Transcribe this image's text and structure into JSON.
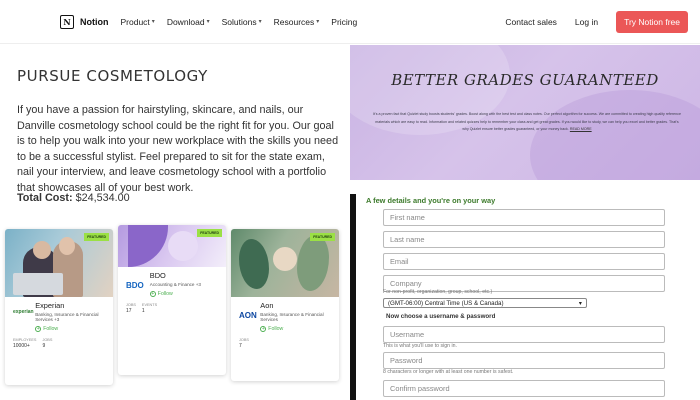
{
  "nav": {
    "logo_text": "Notion",
    "menu": [
      {
        "label": "Product",
        "has_chevron": true
      },
      {
        "label": "Download",
        "has_chevron": true
      },
      {
        "label": "Solutions",
        "has_chevron": true
      },
      {
        "label": "Resources",
        "has_chevron": true
      },
      {
        "label": "Pricing",
        "has_chevron": false
      }
    ],
    "contact": "Contact sales",
    "login": "Log in",
    "cta": "Try Notion free",
    "cta_color": "#eb5757"
  },
  "cosmo": {
    "title": "PURSUE COSMETOLOGY",
    "body": "If you have a passion for hairstyling, skincare, and nails, our Danville cosmetology school could be the right fit for you. Our goal is to help you walk into your new workplace with the skills you need to be a successful stylist. Feel prepared to sit for the state exam, nail your interview, and leave cosmetology school with a portfolio that showcases all of your best work.",
    "cost_label": "Total Cost:",
    "cost_value": "$24,534.00"
  },
  "banner": {
    "title": "BETTER GRADES GUARANTEED",
    "small_text": "It's a proven fact that Quizlet study boosts students' grades. Boost along with the best test and class notes. Our perfect algorithm for success. We are committed to creating high quality reference materials which are easy to read. Information and related quizzes help to remember your class and get great grades. If you would like to study, we can help you excel and better grades. That's why Quizlet ensure better grades guaranteed, or your money back.",
    "link": "READ MORE"
  },
  "cards": [
    {
      "name": "Experian",
      "category": "Banking, Insurance & Financial Services +3",
      "badge": "FEATURED",
      "follow": "Follow",
      "stats": [
        {
          "label": "EMPLOYEES",
          "value": "10000+"
        },
        {
          "label": "JOBS",
          "value": "9"
        }
      ],
      "logo_color": "#2e7d32"
    },
    {
      "name": "BDO",
      "category": "Accounting & Finance +3",
      "badge": "FEATURED",
      "follow": "Follow",
      "stats": [
        {
          "label": "JOBS",
          "value": "17"
        },
        {
          "label": "EVENTS",
          "value": "1"
        }
      ],
      "logo_color": "#1565c0"
    },
    {
      "name": "Aon",
      "category": "Banking, Insurance & Financial Services",
      "badge": "FEATURED",
      "follow": "Follow",
      "stats": [
        {
          "label": "JOBS",
          "value": "7"
        }
      ],
      "logo_color": "#0d47a1"
    }
  ],
  "form": {
    "heading": "A few details and you're on your way",
    "first_name": "First name",
    "last_name": "Last name",
    "email": "Email",
    "company": "Company",
    "company_hint": "For non-profit, organization, group, school, etc.)",
    "timezone": "(GMT-06:00) Central Time (US & Canada)",
    "section": "Now choose a username & password",
    "username": "Username",
    "username_hint": "This is what you'll use to sign in.",
    "password": "Password",
    "password_hint": "8 characters or longer with at least one number is safest.",
    "confirm": "Confirm password"
  }
}
